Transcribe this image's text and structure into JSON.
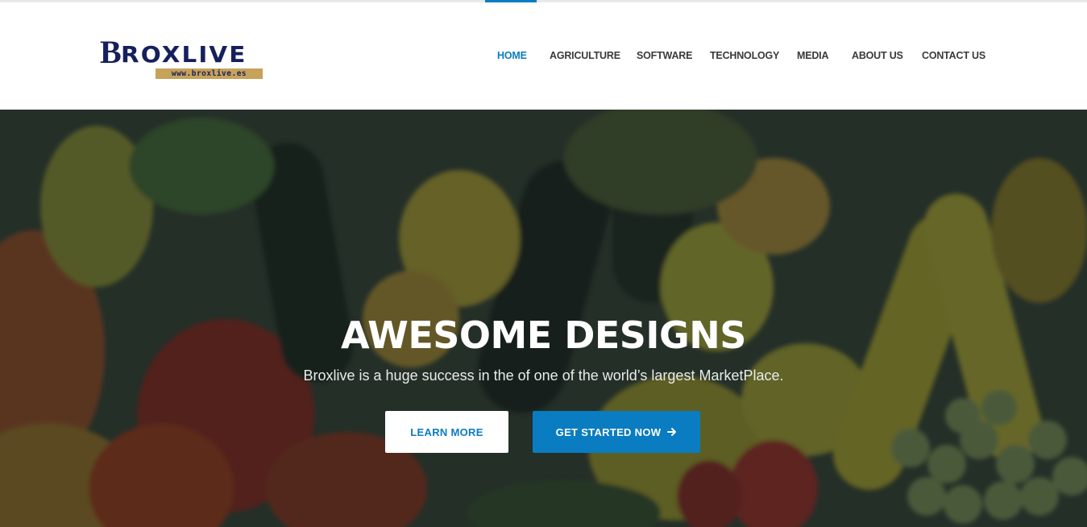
{
  "logo": {
    "initial": "B",
    "rest": "ROXLIVE",
    "url": "www.broxlive.es"
  },
  "nav": {
    "items": [
      {
        "label": "HOME",
        "active": true
      },
      {
        "label": "AGRICULTURE",
        "active": false
      },
      {
        "label": "SOFTWARE",
        "active": false
      },
      {
        "label": "TECHNOLOGY",
        "active": false
      },
      {
        "label": "MEDIA",
        "active": false
      },
      {
        "label": "ABOUT US",
        "active": false
      },
      {
        "label": "CONTACT US",
        "active": false
      }
    ]
  },
  "hero": {
    "background": "fruits-and-vegetables-photo",
    "title": "AWESOME DESIGNS",
    "subtitle": "Broxlive is a huge success in the of one of the world’s largest MarketPlace.",
    "buttons": {
      "learn_more": "LEARN MORE",
      "get_started": "GET STARTED NOW",
      "get_started_icon": "arrow-right-icon"
    }
  },
  "colors": {
    "accent": "#0a7cc1",
    "logo_navy": "#16205c",
    "logo_gold": "#c7a25a",
    "nav_text": "#3a3a3a"
  }
}
